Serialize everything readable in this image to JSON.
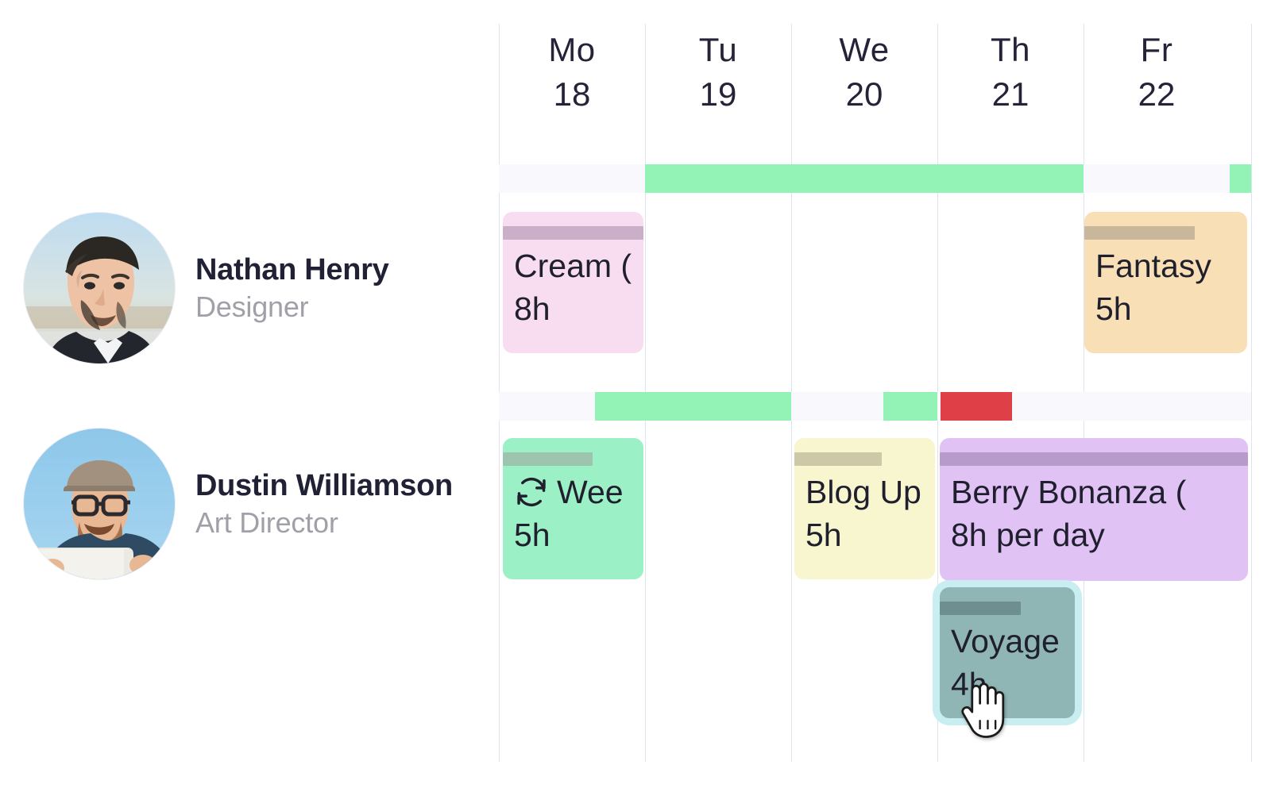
{
  "calendar": {
    "days": [
      {
        "dow": "Mo",
        "date": "18"
      },
      {
        "dow": "Tu",
        "date": "19"
      },
      {
        "dow": "We",
        "date": "20"
      },
      {
        "dow": "Th",
        "date": "21"
      },
      {
        "dow": "Fr",
        "date": "22"
      }
    ]
  },
  "resources": [
    {
      "name": "Nathan Henry",
      "role": "Designer",
      "avatar_icon": "avatar-photo-nathan"
    },
    {
      "name": "Dustin Williamson",
      "role": "Art Director",
      "avatar_icon": "avatar-photo-dustin"
    }
  ],
  "tasks": [
    {
      "id": "cream",
      "title": "Cream (",
      "duration": "8h",
      "row": 0,
      "color": "#f8ddf1",
      "progress_color": "#cbafc8",
      "progress_pct": 100,
      "recurring": false,
      "selected": false
    },
    {
      "id": "fantasy",
      "title": "Fantasy",
      "duration": "5h",
      "row": 0,
      "color": "#f8dfb6",
      "progress_color": "#c9b79b",
      "progress_pct": 68,
      "recurring": false,
      "selected": false
    },
    {
      "id": "weekly",
      "title": "Wee",
      "duration": "5h",
      "row": 1,
      "color": "#9cf0c6",
      "progress_color": "#9dc4af",
      "progress_pct": 64,
      "recurring": true,
      "recurring_icon": "repeat-icon",
      "selected": false
    },
    {
      "id": "blog-update",
      "title": "Blog Up",
      "duration": "5h",
      "row": 1,
      "color": "#f8f6ce",
      "progress_color": "#cdc9a8",
      "progress_pct": 68,
      "recurring": false,
      "selected": false
    },
    {
      "id": "berry-bonanza",
      "title": "Berry Bonanza (",
      "duration": "8h per day",
      "row": 1,
      "color": "#e0c2f5",
      "progress_color": "#b79ccb",
      "progress_pct": 100,
      "recurring": false,
      "selected": false
    },
    {
      "id": "voyage",
      "title": "Voyage",
      "duration": "4h",
      "row": 1,
      "color": "#8fb5b5",
      "progress_color": "#6e8e8f",
      "progress_pct": 60,
      "recurring": false,
      "selected": true,
      "selection_color": "#c8eef2"
    }
  ],
  "availability": {
    "row0": [
      {
        "kind": "ok",
        "label": "available"
      },
      {
        "kind": "ok",
        "label": "available"
      }
    ],
    "row1": [
      {
        "kind": "ok",
        "label": "available"
      },
      {
        "kind": "ok",
        "label": "available"
      },
      {
        "kind": "over",
        "label": "overbooked"
      }
    ]
  },
  "colors": {
    "grid_line": "#dfe3ef",
    "strip_background": "#f8f8fd",
    "available": "#93f3b6",
    "overbooked": "#df3f46",
    "text_primary": "#212135",
    "text_muted": "#a0a0a8"
  },
  "cursor": {
    "icon": "grabbing-hand-cursor"
  }
}
